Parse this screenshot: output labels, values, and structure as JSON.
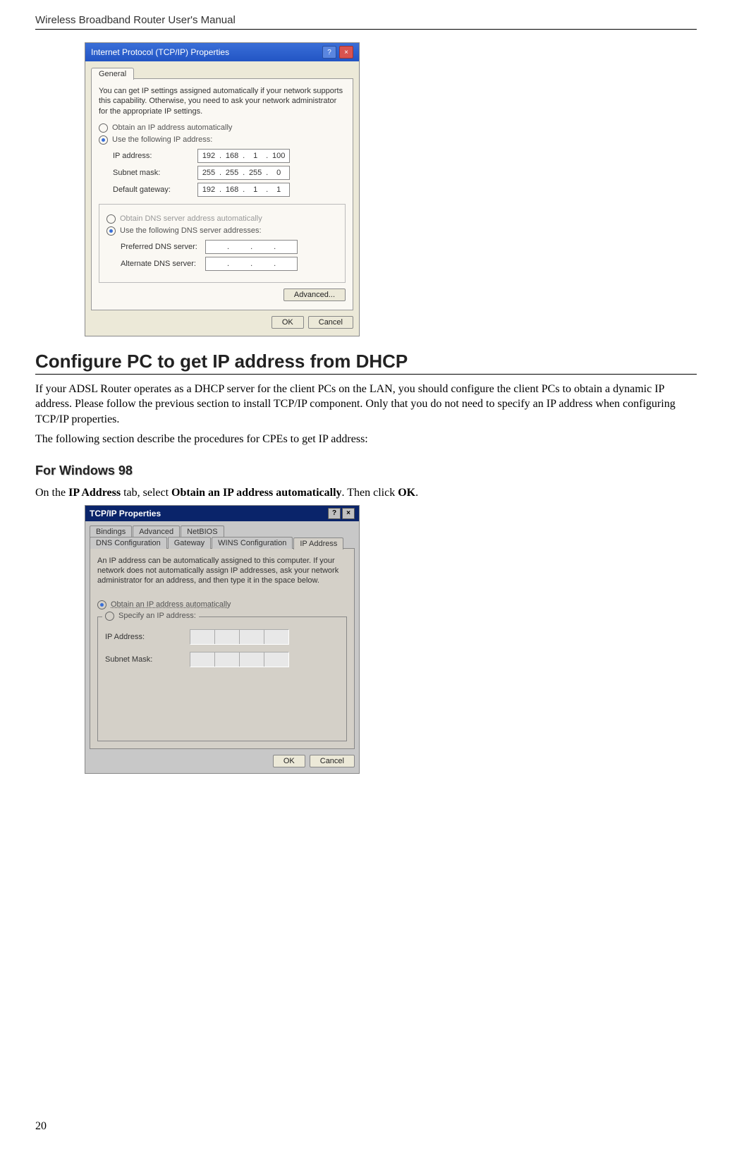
{
  "header": "Wireless Broadband Router User's Manual",
  "page_number": "20",
  "xp": {
    "title": "Internet Protocol (TCP/IP) Properties",
    "tab_general": "General",
    "desc": "You can get IP settings assigned automatically if your network supports this capability. Otherwise, you need to ask your network administrator for the appropriate IP settings.",
    "radio_auto_ip": "Obtain an IP address automatically",
    "radio_use_ip": "Use the following IP address:",
    "lbl_ip": "IP address:",
    "lbl_mask": "Subnet mask:",
    "lbl_gw": "Default gateway:",
    "ip": [
      "192",
      "168",
      "1",
      "100"
    ],
    "mask": [
      "255",
      "255",
      "255",
      "0"
    ],
    "gw": [
      "192",
      "168",
      "1",
      "1"
    ],
    "radio_auto_dns": "Obtain DNS server address automatically",
    "radio_use_dns": "Use the following DNS server addresses:",
    "lbl_pref_dns": "Preferred DNS server:",
    "lbl_alt_dns": "Alternate DNS server:",
    "btn_adv": "Advanced...",
    "btn_ok": "OK",
    "btn_cancel": "Cancel"
  },
  "section_title": "Configure PC to get IP address from DHCP",
  "para1": "If your ADSL Router operates as a DHCP server for the client PCs on the LAN, you should configure the client PCs to obtain a dynamic IP address. Please follow the previous section to install TCP/IP component. Only that you do not need to specify an IP address when configuring TCP/IP properties.",
  "para2": "The following section describe the procedures for CPEs to get IP address:",
  "sub_title": "For Windows 98",
  "para3_pre": "On the ",
  "para3_b1": "IP Address",
  "para3_mid1": " tab, select ",
  "para3_b2": "Obtain an IP address automatically",
  "para3_mid2": ". Then click ",
  "para3_b3": "OK",
  "para3_end": ".",
  "w98": {
    "title": "TCP/IP Properties",
    "tabs_row1": [
      "Bindings",
      "Advanced",
      "NetBIOS"
    ],
    "tabs_row2": [
      "DNS Configuration",
      "Gateway",
      "WINS Configuration",
      "IP Address"
    ],
    "desc": "An IP address can be automatically assigned to this computer. If your network does not automatically assign IP addresses, ask your network administrator for an address, and then type it in the space below.",
    "radio_obtain": "Obtain an IP address automatically",
    "radio_specify": "Specify an IP address:",
    "lbl_ip": "IP Address:",
    "lbl_mask": "Subnet Mask:",
    "btn_ok": "OK",
    "btn_cancel": "Cancel"
  }
}
